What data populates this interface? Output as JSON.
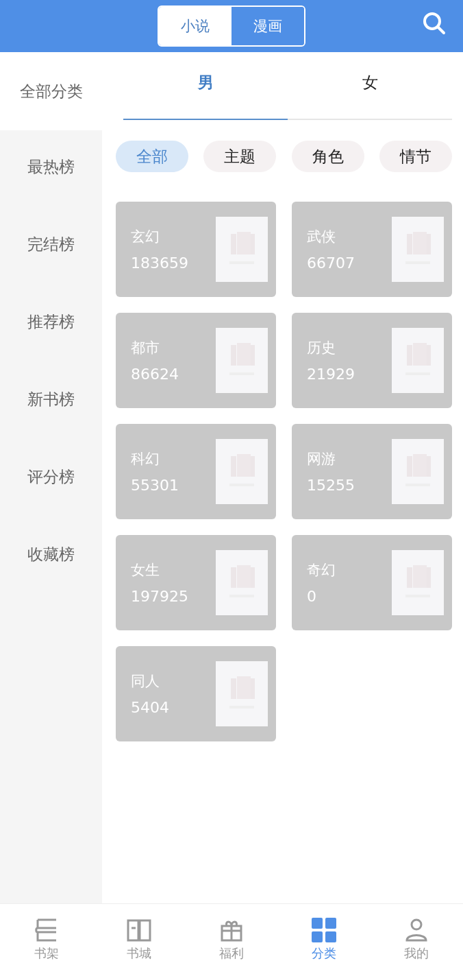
{
  "header": {
    "modes": [
      {
        "label": "小说",
        "selected": true
      },
      {
        "label": "漫画",
        "selected": false
      }
    ]
  },
  "sidebar": {
    "title": "全部分类",
    "items": [
      {
        "label": "最热榜",
        "selected": false
      },
      {
        "label": "完结榜",
        "selected": false
      },
      {
        "label": "推荐榜",
        "selected": false
      },
      {
        "label": "新书榜",
        "selected": false
      },
      {
        "label": "评分榜",
        "selected": false
      },
      {
        "label": "收藏榜",
        "selected": false
      }
    ]
  },
  "gender_tabs": [
    {
      "label": "男",
      "selected": true
    },
    {
      "label": "女",
      "selected": false
    }
  ],
  "filters": [
    {
      "label": "全部",
      "selected": true
    },
    {
      "label": "主题",
      "selected": false
    },
    {
      "label": "角色",
      "selected": false
    },
    {
      "label": "情节",
      "selected": false
    }
  ],
  "categories": [
    {
      "name": "玄幻",
      "count": "183659"
    },
    {
      "name": "武侠",
      "count": "66707"
    },
    {
      "name": "都市",
      "count": "86624"
    },
    {
      "name": "历史",
      "count": "21929"
    },
    {
      "name": "科幻",
      "count": "55301"
    },
    {
      "name": "网游",
      "count": "15255"
    },
    {
      "name": "女生",
      "count": "197925"
    },
    {
      "name": "奇幻",
      "count": "0"
    },
    {
      "name": "同人",
      "count": "5404"
    }
  ],
  "bottom_nav": [
    {
      "label": "书架",
      "kind": "shelf",
      "selected": false
    },
    {
      "label": "书城",
      "kind": "book",
      "selected": false
    },
    {
      "label": "福利",
      "kind": "gift",
      "selected": false
    },
    {
      "label": "分类",
      "kind": "grid",
      "selected": true
    },
    {
      "label": "我的",
      "kind": "person",
      "selected": false
    }
  ]
}
